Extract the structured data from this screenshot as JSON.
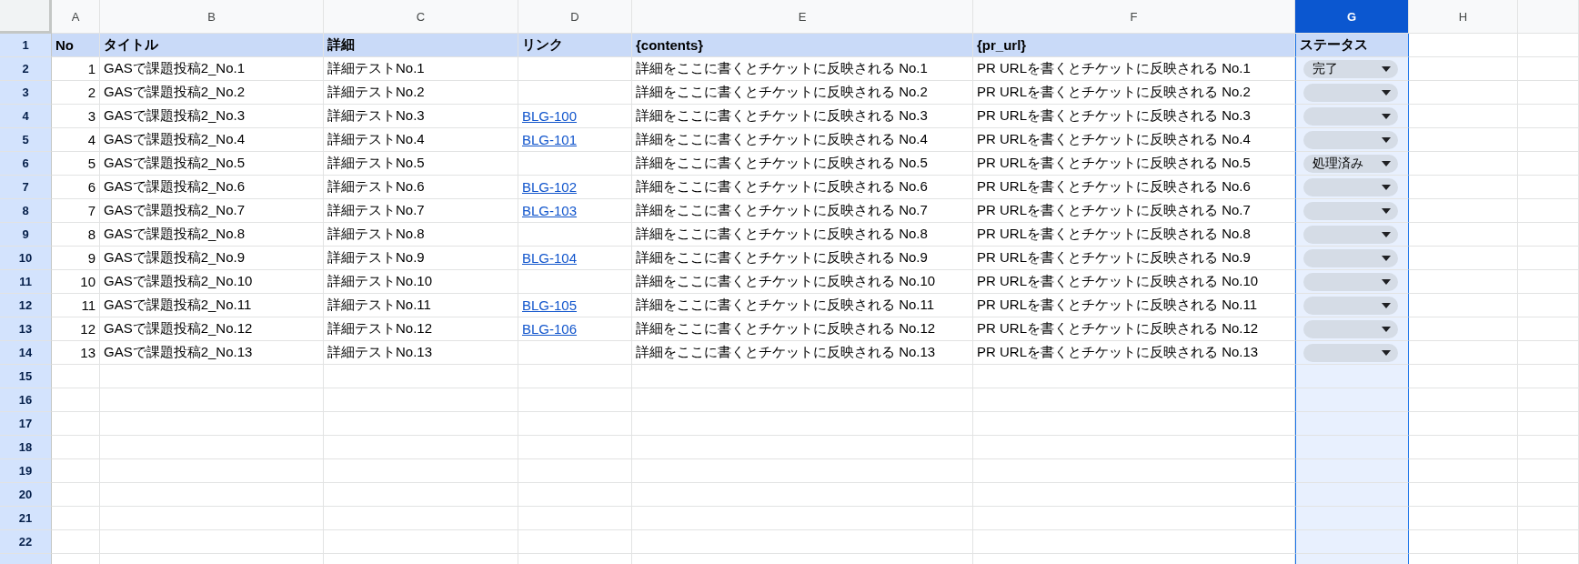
{
  "column_headers": [
    {
      "label": "A",
      "selected": false
    },
    {
      "label": "B",
      "selected": false
    },
    {
      "label": "C",
      "selected": false
    },
    {
      "label": "D",
      "selected": false
    },
    {
      "label": "E",
      "selected": false
    },
    {
      "label": "F",
      "selected": false
    },
    {
      "label": "G",
      "selected": true
    },
    {
      "label": "H",
      "selected": false
    }
  ],
  "row_numbers": [
    "1",
    "2",
    "3",
    "4",
    "5",
    "6",
    "7",
    "8",
    "9",
    "10",
    "11",
    "12",
    "13",
    "14",
    "15",
    "16",
    "17",
    "18",
    "19",
    "20",
    "21",
    "22"
  ],
  "header_row": [
    "No",
    "タイトル",
    "詳細",
    "リンク",
    "{contents}",
    "{pr_url}",
    "ステータス"
  ],
  "rows": [
    {
      "no": "1",
      "title": "GASで課題投稿2_No.1",
      "detail": "詳細テストNo.1",
      "contents": "詳細をここに書くとチケットに反映される No.1",
      "pr_url": "PR URLを書くとチケットに反映される No.1",
      "status": "完了"
    },
    {
      "no": "2",
      "title": "GASで課題投稿2_No.2",
      "detail": "詳細テストNo.2",
      "contents": "詳細をここに書くとチケットに反映される No.2",
      "pr_url": "PR URLを書くとチケットに反映される No.2"
    },
    {
      "no": "3",
      "title": "GASで課題投稿2_No.3",
      "detail": "詳細テストNo.3",
      "link": "BLG-100",
      "contents": "詳細をここに書くとチケットに反映される No.3",
      "pr_url": "PR URLを書くとチケットに反映される No.3"
    },
    {
      "no": "4",
      "title": "GASで課題投稿2_No.4",
      "detail": "詳細テストNo.4",
      "link": "BLG-101",
      "contents": "詳細をここに書くとチケットに反映される No.4",
      "pr_url": "PR URLを書くとチケットに反映される No.4"
    },
    {
      "no": "5",
      "title": "GASで課題投稿2_No.5",
      "detail": "詳細テストNo.5",
      "contents": "詳細をここに書くとチケットに反映される No.5",
      "pr_url": "PR URLを書くとチケットに反映される No.5",
      "status": "処理済み"
    },
    {
      "no": "6",
      "title": "GASで課題投稿2_No.6",
      "detail": "詳細テストNo.6",
      "link": "BLG-102",
      "contents": "詳細をここに書くとチケットに反映される No.6",
      "pr_url": "PR URLを書くとチケットに反映される No.6"
    },
    {
      "no": "7",
      "title": "GASで課題投稿2_No.7",
      "detail": "詳細テストNo.7",
      "link": "BLG-103",
      "contents": "詳細をここに書くとチケットに反映される No.7",
      "pr_url": "PR URLを書くとチケットに反映される No.7"
    },
    {
      "no": "8",
      "title": "GASで課題投稿2_No.8",
      "detail": "詳細テストNo.8",
      "contents": "詳細をここに書くとチケットに反映される No.8",
      "pr_url": "PR URLを書くとチケットに反映される No.8"
    },
    {
      "no": "9",
      "title": "GASで課題投稿2_No.9",
      "detail": "詳細テストNo.9",
      "link": "BLG-104",
      "contents": "詳細をここに書くとチケットに反映される No.9",
      "pr_url": "PR URLを書くとチケットに反映される No.9"
    },
    {
      "no": "10",
      "title": "GASで課題投稿2_No.10",
      "detail": "詳細テストNo.10",
      "contents": "詳細をここに書くとチケットに反映される No.10",
      "pr_url": "PR URLを書くとチケットに反映される No.10"
    },
    {
      "no": "11",
      "title": "GASで課題投稿2_No.11",
      "detail": "詳細テストNo.11",
      "link": "BLG-105",
      "contents": "詳細をここに書くとチケットに反映される No.11",
      "pr_url": "PR URLを書くとチケットに反映される No.11"
    },
    {
      "no": "12",
      "title": "GASで課題投稿2_No.12",
      "detail": "詳細テストNo.12",
      "link": "BLG-106",
      "contents": "詳細をここに書くとチケットに反映される No.12",
      "pr_url": "PR URLを書くとチケットに反映される No.12"
    },
    {
      "no": "13",
      "title": "GASで課題投稿2_No.13",
      "detail": "詳細テストNo.13",
      "contents": "詳細をここに書くとチケットに反映される No.13",
      "pr_url": "PR URLを書くとチケットに反映される No.13"
    }
  ]
}
